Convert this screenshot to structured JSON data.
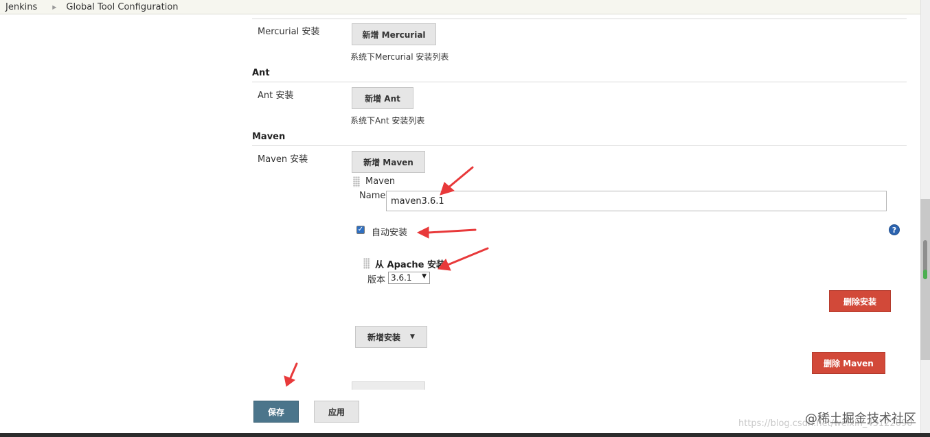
{
  "breadcrumb": {
    "root": "Jenkins",
    "page": "Global Tool Configuration"
  },
  "mercurial": {
    "label": "Mercurial 安装",
    "add_button": "新增 Mercurial",
    "desc": "系统下Mercurial 安装列表"
  },
  "ant": {
    "title": "Ant",
    "label": "Ant 安装",
    "add_button": "新增 Ant",
    "desc": "系统下Ant 安装列表"
  },
  "maven": {
    "title": "Maven",
    "label": "Maven 安装",
    "add_button": "新增 Maven",
    "item_title": "Maven",
    "name_label": "Name",
    "name_value": "maven3.6.1",
    "auto_install_label": "自动安装",
    "auto_install_checked": true,
    "installer_title": "从 Apache 安装",
    "version_label": "版本",
    "version_value": "3.6.1",
    "delete_installer_button": "删除安装",
    "add_installer_button": "新增安装",
    "delete_maven_button": "删除 Maven",
    "help_icon": "?"
  },
  "footer": {
    "save_button": "保存",
    "apply_button": "应用"
  },
  "watermark": {
    "url": "https://blog.csdn.net/weixin_43122090",
    "brand": "@稀土掘金技术社区"
  },
  "colors": {
    "annotation_arrow": "#e8393a",
    "danger": "#d24939",
    "primary": "#4b758b"
  }
}
